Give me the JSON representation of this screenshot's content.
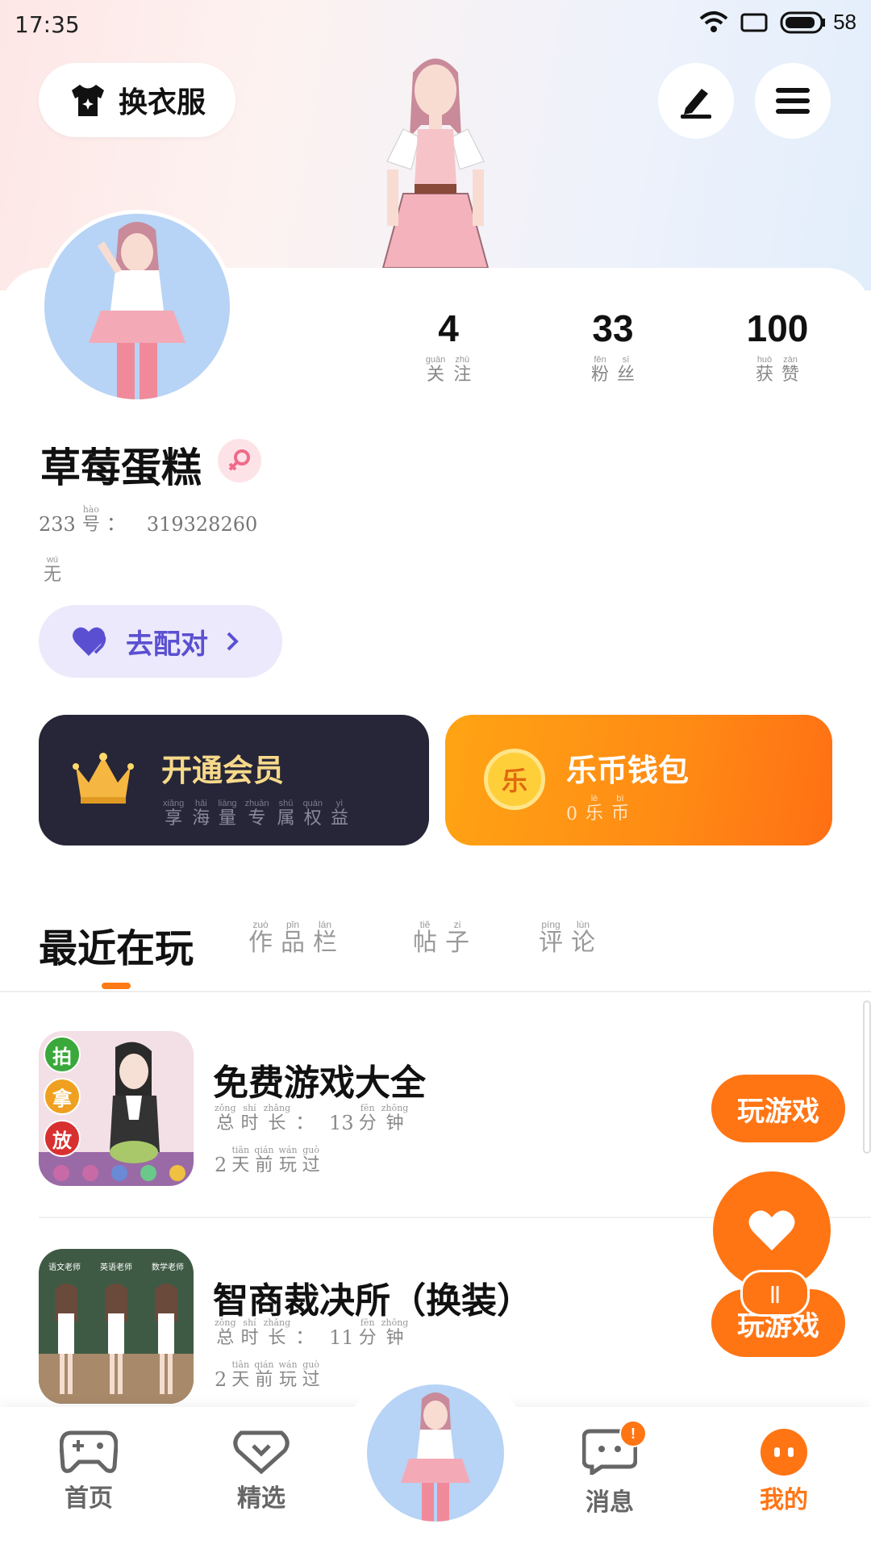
{
  "status_bar": {
    "time": "17:35",
    "battery": "58"
  },
  "header": {
    "change_clothes_label": "换衣服"
  },
  "stats": [
    {
      "value": "4",
      "label": [
        {
          "py": "guān",
          "hz": "关"
        },
        {
          "py": "zhù",
          "hz": "注"
        }
      ]
    },
    {
      "value": "33",
      "label": [
        {
          "py": "fěn",
          "hz": "粉"
        },
        {
          "py": "sī",
          "hz": "丝"
        }
      ]
    },
    {
      "value": "100",
      "label": [
        {
          "py": "huò",
          "hz": "获"
        },
        {
          "py": "zàn",
          "hz": "赞"
        }
      ]
    }
  ],
  "profile": {
    "username": "草莓蛋糕",
    "id_prefix": "233",
    "id_label": {
      "py": "hào",
      "hz": "号"
    },
    "id_colon": "：",
    "id_value": "319328260",
    "bio": {
      "py": "wú",
      "hz": "无"
    },
    "match_label": "去配对"
  },
  "vip_card": {
    "title": "开通会员",
    "subtitle": [
      {
        "py": "xiǎng",
        "hz": "享"
      },
      {
        "py": "hǎi",
        "hz": "海"
      },
      {
        "py": "liàng",
        "hz": "量"
      },
      {
        "py": "zhuān",
        "hz": "专"
      },
      {
        "py": "shǔ",
        "hz": "属"
      },
      {
        "py": "quán",
        "hz": "权"
      },
      {
        "py": "yì",
        "hz": "益"
      }
    ]
  },
  "wallet_card": {
    "title": "乐币钱包",
    "coin_symbol": "乐",
    "amount": "0",
    "unit": [
      {
        "py": "lè",
        "hz": "乐"
      },
      {
        "py": "bì",
        "hz": "币"
      }
    ]
  },
  "tabs": {
    "recent": "最近在玩",
    "works": [
      {
        "py": "zuò",
        "hz": "作"
      },
      {
        "py": "pǐn",
        "hz": "品"
      },
      {
        "py": "lán",
        "hz": "栏"
      }
    ],
    "posts": [
      {
        "py": "tiě",
        "hz": "帖"
      },
      {
        "py": "zi",
        "hz": "子"
      }
    ],
    "comments": [
      {
        "py": "píng",
        "hz": "评"
      },
      {
        "py": "lùn",
        "hz": "论"
      }
    ]
  },
  "games": [
    {
      "title": "免费游戏大全",
      "duration_value": "13",
      "last_played_value": "2",
      "play_label": "玩游戏",
      "thumb_buttons": [
        "拍",
        "拿",
        "放"
      ]
    },
    {
      "title": "智商裁决所（换装）",
      "duration_value": "11",
      "last_played_value": "2",
      "play_label": "玩游戏",
      "thumb_signs": [
        "语文老师",
        "英语老师",
        "数学老师"
      ]
    }
  ],
  "meta_labels": {
    "duration": [
      {
        "py": "zǒng",
        "hz": "总"
      },
      {
        "py": "shí",
        "hz": "时"
      },
      {
        "py": "zhǎng",
        "hz": "长"
      }
    ],
    "colon": "：",
    "minutes": [
      {
        "py": "fēn",
        "hz": "分"
      },
      {
        "py": "zhōng",
        "hz": "钟"
      }
    ],
    "ago": [
      {
        "py": "tiān",
        "hz": "天"
      },
      {
        "py": "qián",
        "hz": "前"
      },
      {
        "py": "wán",
        "hz": "玩"
      },
      {
        "py": "guò",
        "hz": "过"
      }
    ]
  },
  "float": {
    "pause_label": "||"
  },
  "bottom_nav": {
    "home": "首页",
    "featured": "精选",
    "messages": "消息",
    "messages_badge": "!",
    "mine": "我的"
  },
  "colors": {
    "accent": "#ff7514",
    "vip_gold": "#f7d98a",
    "match_purple": "#5b4fd1"
  }
}
